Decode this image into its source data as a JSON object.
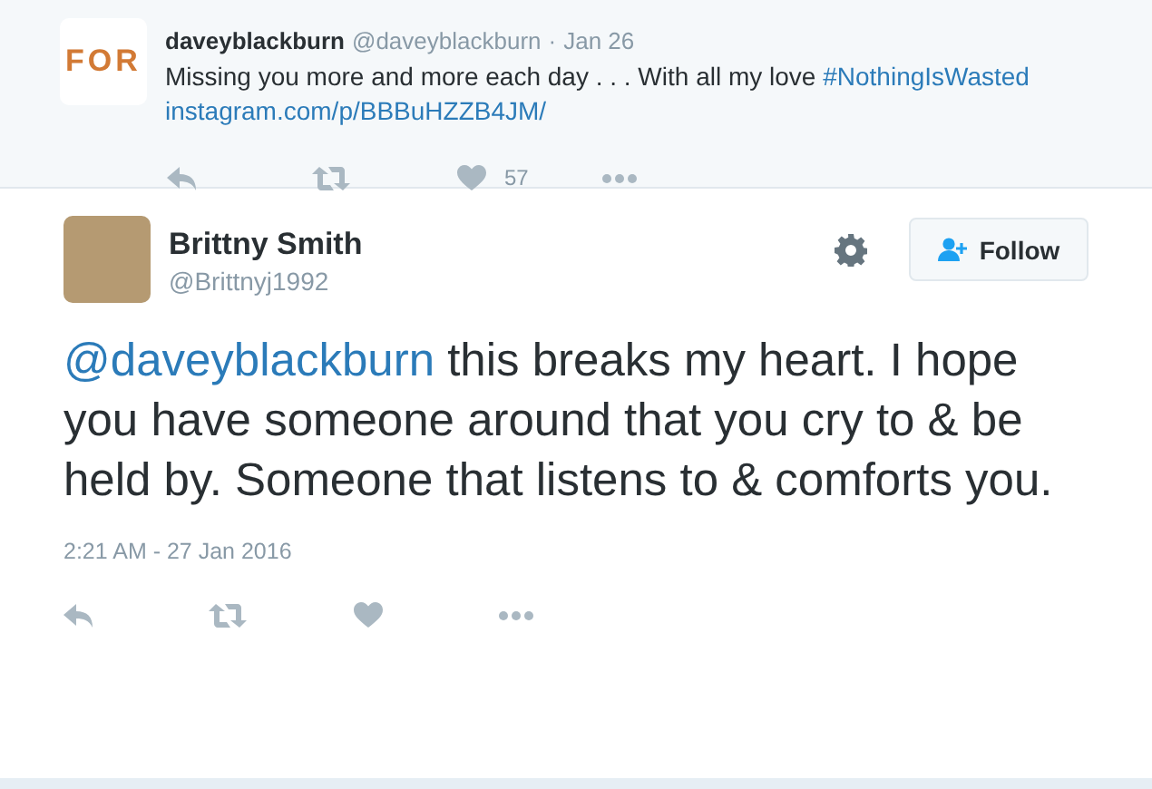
{
  "parent_tweet": {
    "logo": "FOR",
    "name": "daveyblackburn",
    "handle": "@daveyblackburn",
    "separator": "·",
    "date": "Jan 26",
    "text": "Missing you more and more each day . . . With all my love ",
    "hashtag": "#NothingIsWasted",
    "link": "instagram.com/p/BBBuHZZB4JM/",
    "actions": [
      {
        "kind": "reply"
      },
      {
        "kind": "retweet"
      },
      {
        "kind": "like",
        "count": "57"
      },
      {
        "kind": "more"
      }
    ]
  },
  "tweet": {
    "name": "Brittny Smith",
    "handle": "@Brittnyj1992",
    "follow_button": "Follow",
    "mention": "@daveyblackburn",
    "text": " this breaks my heart. I hope you have someone around that you cry to & be held by. Someone that listens to & comforts you.",
    "timestamp": "2:21 AM - 27 Jan 2016",
    "actions": [
      {
        "kind": "reply"
      },
      {
        "kind": "retweet"
      },
      {
        "kind": "like"
      },
      {
        "kind": "more"
      }
    ]
  }
}
